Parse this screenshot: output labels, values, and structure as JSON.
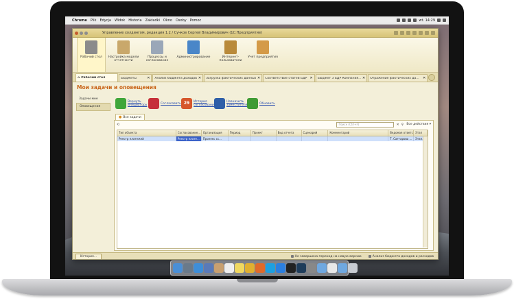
{
  "menubar": {
    "items": [
      "Chrome",
      "Plik",
      "Edycja",
      "Widok",
      "Historia",
      "Zakładki",
      "Okno",
      "Osoby",
      "Pomoc"
    ],
    "clock": "wt. 14:29"
  },
  "window": {
    "title": "Управление холдингом, редакция 1.2 / Сучков Сергей Владимирович (1С:Предприятие)"
  },
  "sections": [
    {
      "label": "Рабочий стол",
      "icon": "desktop-icon",
      "color": "#8b8b8b"
    },
    {
      "label": "Настройка модели отчетности",
      "icon": "clipboard-icon",
      "color": "#c9a86b"
    },
    {
      "label": "Процессы и согласование",
      "icon": "documents-icon",
      "color": "#9aa7b8"
    },
    {
      "label": "Администрирование",
      "icon": "computer-icon",
      "color": "#4a86c8"
    },
    {
      "label": "Интернет-пользователи",
      "icon": "book-icon",
      "color": "#b98a3a"
    },
    {
      "label": "Учет предприятия",
      "icon": "person-icon",
      "color": "#d49a48"
    }
  ],
  "tabs": [
    {
      "label": "Рабочий стол",
      "active": true
    },
    {
      "label": "Бюджеты"
    },
    {
      "label": "Анализ бюджета доходов и ..."
    },
    {
      "label": "Загрузка фактических данных"
    },
    {
      "label": "Соответствие статей БДР ..."
    },
    {
      "label": "Бюджет 3 БДР Компания..."
    },
    {
      "label": "Отражение фактических да..."
    }
  ],
  "page": {
    "title": "Мои задачи и оповещения"
  },
  "leftnav": {
    "items": [
      "Задачи мне",
      "Оповещения"
    ]
  },
  "actions": [
    {
      "label": "Вернуть инициатору",
      "icon": "back-arrow-icon",
      "color": "#3fa63a"
    },
    {
      "label": "Согласовать",
      "icon": "signature-icon",
      "color": "#c6303a"
    },
    {
      "label": "История согласования",
      "icon": "calendar-icon",
      "color": "#d6562b",
      "badge": "29"
    },
    {
      "label": "Назначить заместителя",
      "icon": "user-icon",
      "color": "#2f5fa8"
    },
    {
      "label": "Обновить",
      "icon": "refresh-icon",
      "color": "#3f9b34"
    }
  ],
  "subtab": {
    "label": "Все задачи"
  },
  "search": {
    "placeholder": "Поиск (Ctrl+F)"
  },
  "all_actions": "Все действия",
  "grid": {
    "columns": [
      "Тип объекта",
      "Согласование...",
      "Организация",
      "Период",
      "Проект",
      "Вид отчета",
      "Сценарий",
      "Комментарий",
      "Ведомая ответств...",
      "Этап"
    ],
    "rows": [
      [
        "Реестр платежей",
        "Реестр плате...",
        "Пронекс сс...",
        "",
        "",
        "",
        "",
        "",
        "Т. Саттарова ...",
        "Этап..."
      ]
    ]
  },
  "statusbar": {
    "history": "История...",
    "items": [
      "Не завершена переход на новую версию",
      "Анализ бюджета доходов и расходов"
    ]
  },
  "dock": {
    "apps": [
      {
        "name": "finder-icon",
        "color": "#4a8fd6"
      },
      {
        "name": "launchpad-icon",
        "color": "#6a7a8a"
      },
      {
        "name": "safari-icon",
        "color": "#3e8ed8"
      },
      {
        "name": "mail-icon",
        "color": "#5a7ab8"
      },
      {
        "name": "contacts-icon",
        "color": "#c8a070"
      },
      {
        "name": "calendar-app-icon",
        "color": "#eeeeee"
      },
      {
        "name": "notes-icon",
        "color": "#f0d860"
      },
      {
        "name": "chrome-icon",
        "color": "#e0b030"
      },
      {
        "name": "firefox-icon",
        "color": "#e06a2a"
      },
      {
        "name": "skype-icon",
        "color": "#1ea0e0"
      },
      {
        "name": "appstore-icon",
        "color": "#2b7fe0"
      },
      {
        "name": "terminal-icon",
        "color": "#222222"
      },
      {
        "name": "photoshop-icon",
        "color": "#1e3c5a"
      },
      {
        "name": "system-prefs-icon",
        "color": "#888888"
      },
      {
        "name": "folder-icon",
        "color": "#6fa8e0"
      },
      {
        "name": "document-icon",
        "color": "#e8e8e8"
      },
      {
        "name": "downloads-icon",
        "color": "#6fa8e0"
      },
      {
        "name": "trash-icon",
        "color": "#c8ccd2"
      }
    ]
  }
}
